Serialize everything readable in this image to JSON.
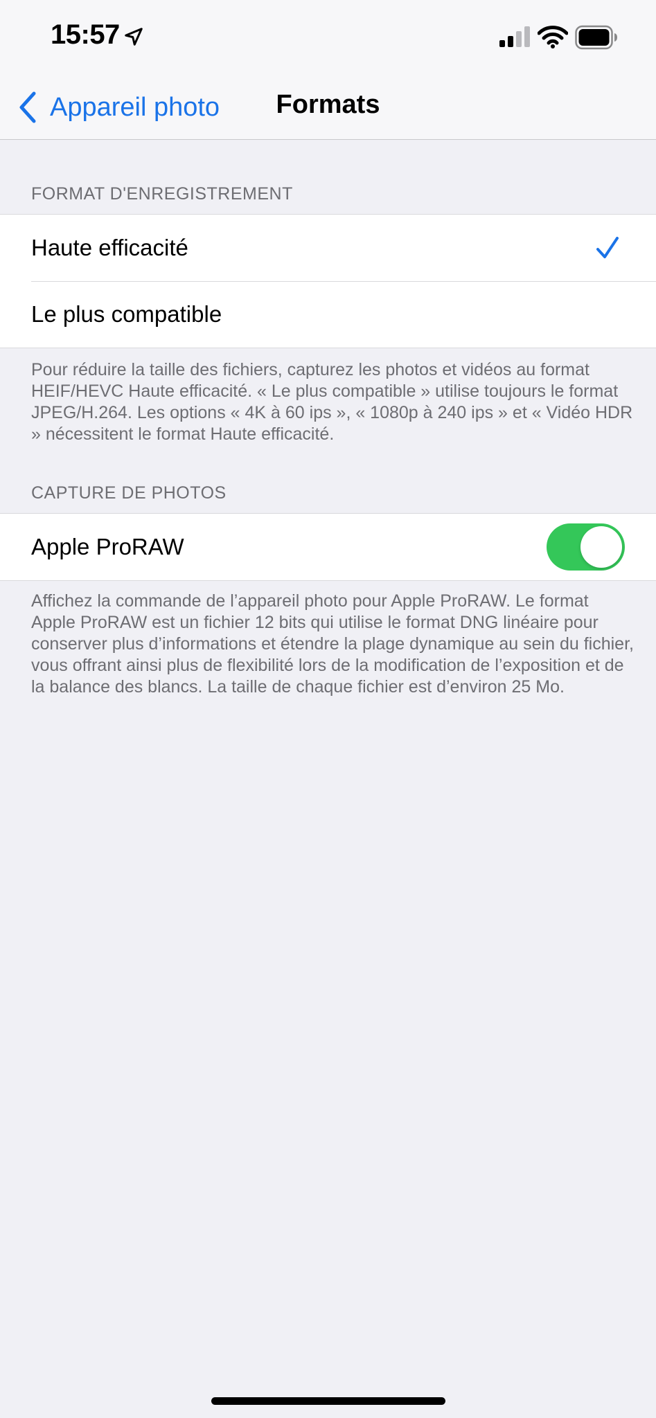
{
  "status_bar": {
    "time": "15:57",
    "icons": [
      "location-arrow-icon",
      "cellular-signal-icon",
      "wifi-icon",
      "battery-icon"
    ]
  },
  "nav": {
    "back_label": "Appareil photo",
    "title": "Formats"
  },
  "colors": {
    "accent": "#1a73e8",
    "toggle_on": "#34c759",
    "background": "#f0f0f5"
  },
  "sections": {
    "recording": {
      "header": "FORMAT D'ENREGISTREMENT",
      "options": [
        {
          "label": "Haute efficacité",
          "selected": true
        },
        {
          "label": "Le plus compatible",
          "selected": false
        }
      ],
      "footer": "Pour réduire la taille des fichiers, capturez les photos et vidéos au format HEIF/HEVC Haute efficacité. « Le plus compatible » utilise toujours le format JPEG/H.264. Les options « 4K à 60 ips », « 1080p à 240 ips » et « Vidéo HDR » nécessitent le format Haute efficacité."
    },
    "capture": {
      "header": "CAPTURE DE PHOTOS",
      "proraw_label": "Apple ProRAW",
      "proraw_enabled": true,
      "footer": "Affichez la commande de l’appareil photo pour Apple ProRAW. Le format Apple ProRAW est un fichier 12 bits qui utilise le format DNG linéaire pour conserver plus d’informations et étendre la plage dynamique au sein du fichier, vous offrant ainsi plus de flexibilité lors de la modification de l’exposition et de la balance des blancs. La taille de chaque fichier est d’environ 25 Mo."
    }
  }
}
